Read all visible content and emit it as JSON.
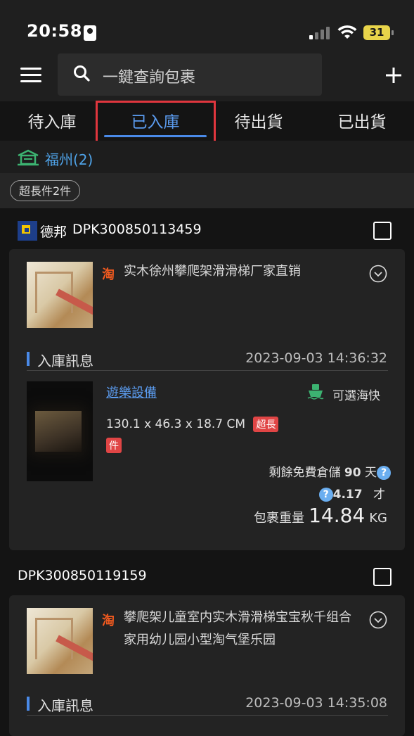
{
  "status_bar": {
    "time": "20:58",
    "battery": "31"
  },
  "header": {
    "search_placeholder": "一鍵查詢包裹"
  },
  "tabs": [
    {
      "label": "待入庫"
    },
    {
      "label": "已入庫"
    },
    {
      "label": "待出貨"
    },
    {
      "label": "已出貨"
    }
  ],
  "active_tab": "已入庫",
  "warehouse": {
    "label": "福州(2)"
  },
  "filter_chip": {
    "label": "超長件2件"
  },
  "packages": [
    {
      "courier": "德邦",
      "tracking": "DPK300850113459",
      "product_title": "实木徐州攀爬架滑滑梯厂家直销",
      "section_label": "入庫訊息",
      "section_time": "2023-09-03 14:36:32",
      "category": "遊樂設備",
      "shipping_option": "可選海快",
      "dimensions": "130.1 x 46.3 x 18.7 CM",
      "oversize_tag": "超長件",
      "storage_label": "剩餘免費倉儲",
      "storage_days": "90",
      "storage_unit": "天",
      "volume_value": "4.17",
      "volume_unit": "才",
      "weight_label": "包裹重量",
      "weight_value": "14.84",
      "weight_unit": "KG"
    },
    {
      "courier": "",
      "tracking": "DPK300850119159",
      "product_title": "攀爬架儿童室内实木滑滑梯宝宝秋千组合家用幼儿园小型淘气堡乐园",
      "section_label": "入庫訊息",
      "section_time": "2023-09-03 14:35:08"
    }
  ],
  "icons": {
    "taobao": "淘",
    "question": "?"
  },
  "colors": {
    "accent": "#4a8ae8",
    "highlight_border": "#e0363e",
    "oversize_tag": "#e04545",
    "taobao": "#f25a1f",
    "ship": "#3cb371"
  }
}
